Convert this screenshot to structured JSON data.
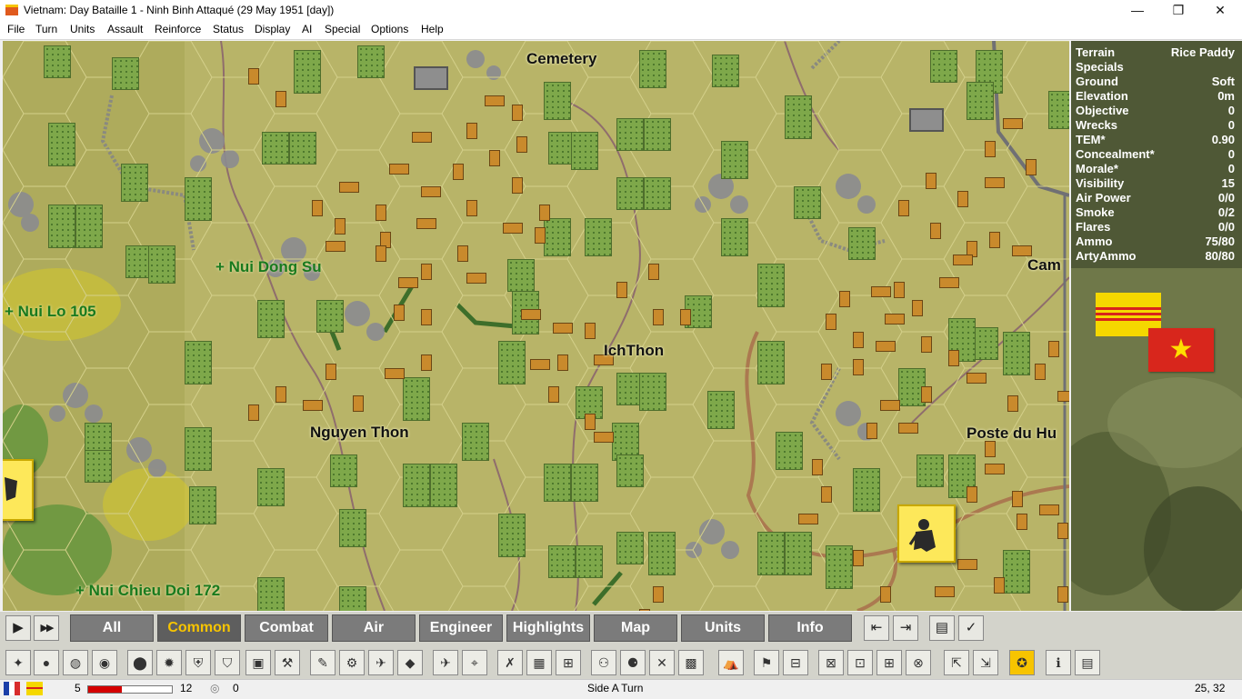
{
  "window": {
    "title": "Vietnam: Day Bataille 1 - Ninh Binh Attaqué (29 May 1951 [day])",
    "minimize": "—",
    "maximize": "❐",
    "close": "✕"
  },
  "menu": [
    "File",
    "Turn",
    "Units",
    "Assault",
    "Reinforce",
    "Status",
    "Display",
    "AI",
    "Special",
    "Options",
    "Help"
  ],
  "map": {
    "labels": [
      "Cemetery",
      "IchThon",
      "Nguyen Thon",
      "Poste du Hu",
      "Cam"
    ],
    "hill_labels": [
      "+ Nui Dong Su",
      "+ Nui Lo 105",
      "+ Nui Chieu Doi 172"
    ]
  },
  "terrain_info": [
    {
      "label": "Terrain",
      "value": "Rice Paddy"
    },
    {
      "label": "Specials",
      "value": ""
    },
    {
      "label": "Ground",
      "value": "Soft"
    },
    {
      "label": "Elevation",
      "value": "0m"
    },
    {
      "label": "Objective",
      "value": "0"
    },
    {
      "label": "Wrecks",
      "value": "0"
    },
    {
      "label": "TEM*",
      "value": "0.90"
    },
    {
      "label": "Concealment*",
      "value": "0"
    },
    {
      "label": "Morale*",
      "value": "0"
    },
    {
      "label": "Visibility",
      "value": "15"
    },
    {
      "label": "Air Power",
      "value": "0/0"
    },
    {
      "label": "Smoke",
      "value": "0/2"
    },
    {
      "label": "Flares",
      "value": "0/0"
    },
    {
      "label": "Ammo",
      "value": "75/80"
    },
    {
      "label": "ArtyAmmo",
      "value": "80/80"
    }
  ],
  "toolbar": {
    "tabs": [
      "All",
      "Common",
      "Combat",
      "Air",
      "Engineer",
      "Highlights",
      "Map",
      "Units",
      "Info"
    ],
    "active_tab": "Common",
    "play_icon": "▶",
    "fast_forward_icon": "▶▶"
  },
  "status": {
    "side_a_value": "5",
    "side_b_value": "12",
    "reserve_value": "0",
    "turn_text": "Side A Turn",
    "coords": "25, 32"
  },
  "colors": {
    "map_base": "#b8b468",
    "hex_line": "#d4d08a",
    "forest": "#6f9a3a",
    "village": "#c98a2c",
    "road": "#8a6a6a",
    "hill_text": "#197a1e",
    "active_tab_text": "#f7c400"
  }
}
